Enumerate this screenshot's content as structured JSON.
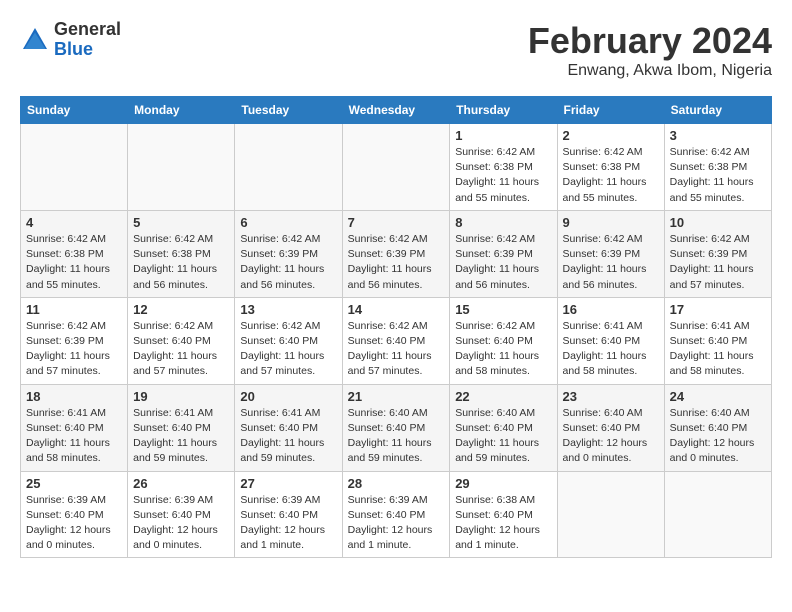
{
  "logo": {
    "general": "General",
    "blue": "Blue"
  },
  "title": "February 2024",
  "subtitle": "Enwang, Akwa Ibom, Nigeria",
  "days_of_week": [
    "Sunday",
    "Monday",
    "Tuesday",
    "Wednesday",
    "Thursday",
    "Friday",
    "Saturday"
  ],
  "weeks": [
    [
      {
        "day": "",
        "details": ""
      },
      {
        "day": "",
        "details": ""
      },
      {
        "day": "",
        "details": ""
      },
      {
        "day": "",
        "details": ""
      },
      {
        "day": "1",
        "details": "Sunrise: 6:42 AM\nSunset: 6:38 PM\nDaylight: 11 hours and 55 minutes."
      },
      {
        "day": "2",
        "details": "Sunrise: 6:42 AM\nSunset: 6:38 PM\nDaylight: 11 hours and 55 minutes."
      },
      {
        "day": "3",
        "details": "Sunrise: 6:42 AM\nSunset: 6:38 PM\nDaylight: 11 hours and 55 minutes."
      }
    ],
    [
      {
        "day": "4",
        "details": "Sunrise: 6:42 AM\nSunset: 6:38 PM\nDaylight: 11 hours and 55 minutes."
      },
      {
        "day": "5",
        "details": "Sunrise: 6:42 AM\nSunset: 6:38 PM\nDaylight: 11 hours and 56 minutes."
      },
      {
        "day": "6",
        "details": "Sunrise: 6:42 AM\nSunset: 6:39 PM\nDaylight: 11 hours and 56 minutes."
      },
      {
        "day": "7",
        "details": "Sunrise: 6:42 AM\nSunset: 6:39 PM\nDaylight: 11 hours and 56 minutes."
      },
      {
        "day": "8",
        "details": "Sunrise: 6:42 AM\nSunset: 6:39 PM\nDaylight: 11 hours and 56 minutes."
      },
      {
        "day": "9",
        "details": "Sunrise: 6:42 AM\nSunset: 6:39 PM\nDaylight: 11 hours and 56 minutes."
      },
      {
        "day": "10",
        "details": "Sunrise: 6:42 AM\nSunset: 6:39 PM\nDaylight: 11 hours and 57 minutes."
      }
    ],
    [
      {
        "day": "11",
        "details": "Sunrise: 6:42 AM\nSunset: 6:39 PM\nDaylight: 11 hours and 57 minutes."
      },
      {
        "day": "12",
        "details": "Sunrise: 6:42 AM\nSunset: 6:40 PM\nDaylight: 11 hours and 57 minutes."
      },
      {
        "day": "13",
        "details": "Sunrise: 6:42 AM\nSunset: 6:40 PM\nDaylight: 11 hours and 57 minutes."
      },
      {
        "day": "14",
        "details": "Sunrise: 6:42 AM\nSunset: 6:40 PM\nDaylight: 11 hours and 57 minutes."
      },
      {
        "day": "15",
        "details": "Sunrise: 6:42 AM\nSunset: 6:40 PM\nDaylight: 11 hours and 58 minutes."
      },
      {
        "day": "16",
        "details": "Sunrise: 6:41 AM\nSunset: 6:40 PM\nDaylight: 11 hours and 58 minutes."
      },
      {
        "day": "17",
        "details": "Sunrise: 6:41 AM\nSunset: 6:40 PM\nDaylight: 11 hours and 58 minutes."
      }
    ],
    [
      {
        "day": "18",
        "details": "Sunrise: 6:41 AM\nSunset: 6:40 PM\nDaylight: 11 hours and 58 minutes."
      },
      {
        "day": "19",
        "details": "Sunrise: 6:41 AM\nSunset: 6:40 PM\nDaylight: 11 hours and 59 minutes."
      },
      {
        "day": "20",
        "details": "Sunrise: 6:41 AM\nSunset: 6:40 PM\nDaylight: 11 hours and 59 minutes."
      },
      {
        "day": "21",
        "details": "Sunrise: 6:40 AM\nSunset: 6:40 PM\nDaylight: 11 hours and 59 minutes."
      },
      {
        "day": "22",
        "details": "Sunrise: 6:40 AM\nSunset: 6:40 PM\nDaylight: 11 hours and 59 minutes."
      },
      {
        "day": "23",
        "details": "Sunrise: 6:40 AM\nSunset: 6:40 PM\nDaylight: 12 hours and 0 minutes."
      },
      {
        "day": "24",
        "details": "Sunrise: 6:40 AM\nSunset: 6:40 PM\nDaylight: 12 hours and 0 minutes."
      }
    ],
    [
      {
        "day": "25",
        "details": "Sunrise: 6:39 AM\nSunset: 6:40 PM\nDaylight: 12 hours and 0 minutes."
      },
      {
        "day": "26",
        "details": "Sunrise: 6:39 AM\nSunset: 6:40 PM\nDaylight: 12 hours and 0 minutes."
      },
      {
        "day": "27",
        "details": "Sunrise: 6:39 AM\nSunset: 6:40 PM\nDaylight: 12 hours and 1 minute."
      },
      {
        "day": "28",
        "details": "Sunrise: 6:39 AM\nSunset: 6:40 PM\nDaylight: 12 hours and 1 minute."
      },
      {
        "day": "29",
        "details": "Sunrise: 6:38 AM\nSunset: 6:40 PM\nDaylight: 12 hours and 1 minute."
      },
      {
        "day": "",
        "details": ""
      },
      {
        "day": "",
        "details": ""
      }
    ]
  ]
}
